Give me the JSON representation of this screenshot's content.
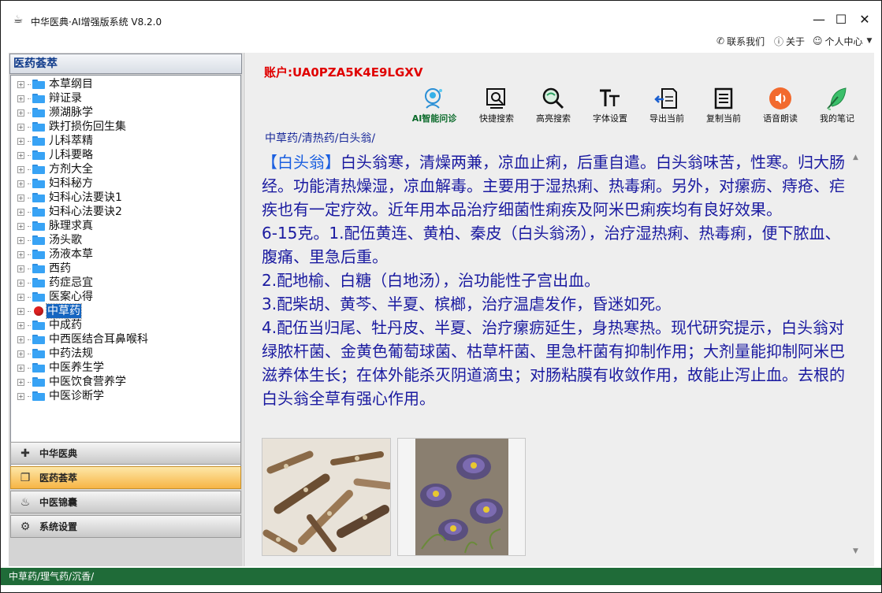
{
  "window": {
    "title": "中华医典·AI增强版系统 V8.2.0",
    "minimize": "—",
    "maximize": "☐",
    "close": "✕"
  },
  "top_menu": {
    "contact": "联系我们",
    "about": "关于",
    "user_center": "个人中心"
  },
  "left_panel": {
    "header": "医药荟萃",
    "tree": [
      {
        "label": "本草纲目"
      },
      {
        "label": "辩证录"
      },
      {
        "label": "濒湖脉学"
      },
      {
        "label": "跌打损伤回生集"
      },
      {
        "label": "儿科萃精"
      },
      {
        "label": "儿科要略"
      },
      {
        "label": "方剂大全"
      },
      {
        "label": "妇科秘方"
      },
      {
        "label": "妇科心法要诀1"
      },
      {
        "label": "妇科心法要诀2"
      },
      {
        "label": "脉理求真"
      },
      {
        "label": "汤头歌"
      },
      {
        "label": "汤液本草"
      },
      {
        "label": "西药"
      },
      {
        "label": "药症忌宜"
      },
      {
        "label": "医案心得"
      },
      {
        "label": "中草药",
        "selected": true
      },
      {
        "label": "中成药"
      },
      {
        "label": "中西医结合耳鼻喉科"
      },
      {
        "label": "中药法规"
      },
      {
        "label": "中医养生学"
      },
      {
        "label": "中医饮食营养学"
      },
      {
        "label": "中医诊断学"
      }
    ],
    "nav": [
      {
        "label": "中华医典",
        "icon": "medkit-icon"
      },
      {
        "label": "医药荟萃",
        "icon": "layers-icon",
        "active": true
      },
      {
        "label": "中医锦囊",
        "icon": "pouch-icon"
      },
      {
        "label": "系统设置",
        "icon": "gear-icon"
      }
    ]
  },
  "content": {
    "account": "账户:UA0PZA5K4E9LGXV",
    "toolbar": [
      {
        "label": "AI智能问诊",
        "icon": "ai-head-icon"
      },
      {
        "label": "快捷搜索",
        "icon": "search-doc-icon"
      },
      {
        "label": "高亮搜索",
        "icon": "magnifier-icon"
      },
      {
        "label": "字体设置",
        "icon": "font-icon"
      },
      {
        "label": "导出当前",
        "icon": "export-icon"
      },
      {
        "label": "复制当前",
        "icon": "copy-icon"
      },
      {
        "label": "语音朗读",
        "icon": "speaker-icon"
      },
      {
        "label": "我的笔记",
        "icon": "quill-icon"
      }
    ],
    "breadcrumb": "中草药/清热药/白头翁/",
    "article": {
      "title": "【白头翁】",
      "p1": "白头翁寒，清燥两兼，凉血止痢，后重自遣。白头翁味苦，性寒。归大肠经。功能清热燥湿，凉血解毒。主要用于湿热痢、热毒痢。另外，对瘰疬、痔疮、疟疾也有一定疗效。近年用本品治疗细菌性痢疾及阿米巴痢疾均有良好效果。",
      "p2": "6-15克。1.配伍黄连、黄柏、秦皮（白头翁汤），治疗湿热痢、热毒痢，便下脓血、腹痛、里急后重。",
      "p3": "2.配地榆、白糖（白地汤），治功能性子宫出血。",
      "p4": "3.配柴胡、黄芩、半夏、槟榔，治疗温虐发作，昏迷如死。",
      "p5": "4.配伍当归尾、牡丹皮、半夏、治疗瘰疬延生，身热寒热。现代研究提示，白头翁对绿脓杆菌、金黄色葡萄球菌、枯草杆菌、里急杆菌有抑制作用；大剂量能抑制阿米巴滋养体生长；在体外能杀灭阴道滴虫；对肠粘膜有收敛作用，故能止泻止血。去根的白头翁全草有强心作用。"
    }
  },
  "statusbar": "中草药/理气药/沉香/",
  "colors": {
    "accent_red": "#e00000",
    "article_blue": "#1a1aa0",
    "status_green": "#1f6b38",
    "selected_blue": "#1565c0",
    "active_orange": "#f7b545"
  }
}
